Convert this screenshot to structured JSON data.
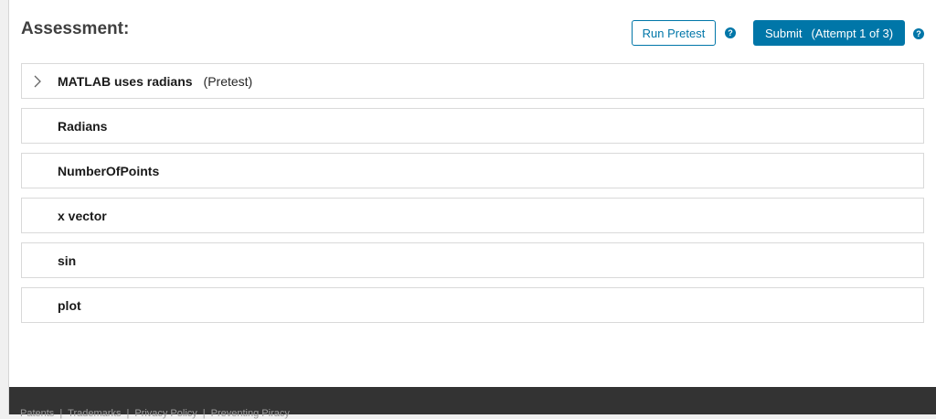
{
  "header": {
    "title": "Assessment:",
    "run_pretest_label": "Run Pretest",
    "help_glyph": "?",
    "submit_label": "Submit",
    "submit_attempt": "(Attempt 1 of 3)"
  },
  "tests": [
    {
      "name": "MATLAB uses radians",
      "tag": "(Pretest)",
      "expandable": true
    },
    {
      "name": "Radians",
      "tag": "",
      "expandable": false
    },
    {
      "name": "NumberOfPoints",
      "tag": "",
      "expandable": false
    },
    {
      "name": "x vector",
      "tag": "",
      "expandable": false
    },
    {
      "name": "sin",
      "tag": "",
      "expandable": false
    },
    {
      "name": "plot",
      "tag": "",
      "expandable": false
    }
  ],
  "footer": {
    "links": [
      "Patents",
      "Trademarks",
      "Privacy Policy",
      "Preventing Piracy"
    ]
  },
  "colors": {
    "accent": "#0076a8",
    "footer_bg": "#333333"
  },
  "icons": {
    "help": "question-circle-icon",
    "expand": "chevron-right-icon"
  }
}
